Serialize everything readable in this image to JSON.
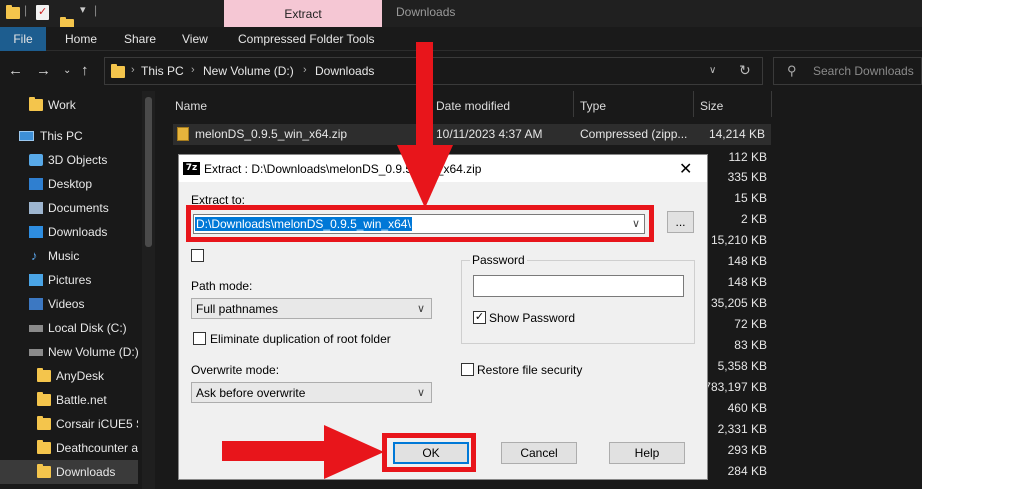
{
  "titlebar": {
    "extract_tab": "Extract",
    "window_title": "Downloads"
  },
  "ribbon": {
    "tabs": [
      "File",
      "Home",
      "Share",
      "View",
      "Compressed Folder Tools"
    ]
  },
  "address": {
    "crumbs": [
      "This PC",
      "New Volume (D:)",
      "Downloads"
    ],
    "search_placeholder": "Search Downloads"
  },
  "nav": {
    "items": [
      {
        "label": "Work",
        "icon": "folder-icon"
      },
      {
        "label": "This PC",
        "icon": "computer-icon"
      },
      {
        "label": "3D Objects",
        "icon": "3d-objects-icon"
      },
      {
        "label": "Desktop",
        "icon": "desktop-icon"
      },
      {
        "label": "Documents",
        "icon": "documents-icon"
      },
      {
        "label": "Downloads",
        "icon": "downloads-icon"
      },
      {
        "label": "Music",
        "icon": "music-icon"
      },
      {
        "label": "Pictures",
        "icon": "pictures-icon"
      },
      {
        "label": "Videos",
        "icon": "videos-icon"
      },
      {
        "label": "Local Disk (C:)",
        "icon": "drive-icon"
      },
      {
        "label": "New Volume (D:)",
        "icon": "drive-icon"
      },
      {
        "label": "AnyDesk",
        "icon": "folder-icon"
      },
      {
        "label": "Battle.net",
        "icon": "folder-icon"
      },
      {
        "label": "Corsair iCUE5 S",
        "icon": "folder-icon"
      },
      {
        "label": "Deathcounter a",
        "icon": "folder-icon"
      },
      {
        "label": "Downloads",
        "icon": "folder-icon"
      }
    ]
  },
  "filelist": {
    "headers": [
      "Name",
      "Date modified",
      "Type",
      "Size"
    ],
    "first_row": {
      "name": "melonDS_0.9.5_win_x64.zip",
      "date": "10/11/2023 4:37 AM",
      "type": "Compressed (zipp...",
      "size": "14,214 KB"
    },
    "sizes": [
      "112 KB",
      "335 KB",
      "15 KB",
      "2 KB",
      "15,210 KB",
      "148 KB",
      "148 KB",
      "35,205 KB",
      "72 KB",
      "83 KB",
      "5,358 KB",
      "783,197 KB",
      "460 KB",
      "2,331 KB",
      "293 KB",
      "284 KB"
    ]
  },
  "dialog": {
    "title": "Extract : D:\\Downloads\\melonDS_0.9.5_win_x64.zip",
    "extract_to_label": "Extract to:",
    "extract_to_value": "D:\\Downloads\\melonDS_0.9.5_win_x64\\",
    "browse_label": "...",
    "path_mode_label": "Path mode:",
    "path_mode_value": "Full pathnames",
    "eliminate_label": "Eliminate duplication of root folder",
    "overwrite_label": "Overwrite mode:",
    "overwrite_value": "Ask before overwrite",
    "password_label": "Password",
    "show_password_label": "Show Password",
    "restore_security_label": "Restore file security",
    "ok_label": "OK",
    "cancel_label": "Cancel",
    "help_label": "Help"
  },
  "colors": {
    "annotation_red": "#e8151b",
    "extract_tab_bg": "#f5c7d4",
    "file_tab_bg": "#1d5d8f",
    "selection_blue": "#0078d7"
  }
}
